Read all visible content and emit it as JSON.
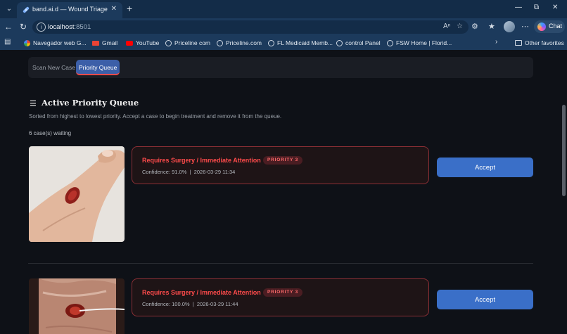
{
  "browser": {
    "tab_title": "band.ai.d — Wound Triage",
    "url_host": "localhost",
    "url_port": ":8501",
    "chat_label": "Chat",
    "bookmarks": [
      {
        "label": "Navegador web G...",
        "icon": "google-icon"
      },
      {
        "label": "Gmail",
        "icon": "gmail-icon"
      },
      {
        "label": "YouTube",
        "icon": "youtube-icon"
      },
      {
        "label": "Priceline com",
        "icon": "globe-icon"
      },
      {
        "label": "Priceline.com",
        "icon": "globe-icon"
      },
      {
        "label": "FL Medicaid Memb...",
        "icon": "globe-icon"
      },
      {
        "label": "control Panel",
        "icon": "globe-icon"
      },
      {
        "label": "FSW Home | Florid...",
        "icon": "globe-icon"
      }
    ],
    "other_favorites": "Other favorites"
  },
  "app": {
    "tabs": [
      {
        "label": "Scan New Case",
        "active": false
      },
      {
        "label": "Priority Queue",
        "active": true
      }
    ],
    "section_title": "Active Priority Queue",
    "section_caption": "Sorted from highest to lowest priority. Accept a case to begin treatment and remove it from the queue.",
    "count_text": "6 case(s) waiting",
    "accent": "#ff4b4b",
    "button_color": "#3a6fc8",
    "cases": [
      {
        "label": "Requires Surgery / Immediate Attention",
        "priority": "PRIORITY 3",
        "confidence": "Confidence: 91.0%",
        "timestamp": "2026-03-29 11:34",
        "accept_label": "Accept"
      },
      {
        "label": "Requires Surgery / Immediate Attention",
        "priority": "PRIORITY 3",
        "confidence": "Confidence: 100.0%",
        "timestamp": "2026-03-29 11:44",
        "accept_label": "Accept"
      }
    ]
  }
}
